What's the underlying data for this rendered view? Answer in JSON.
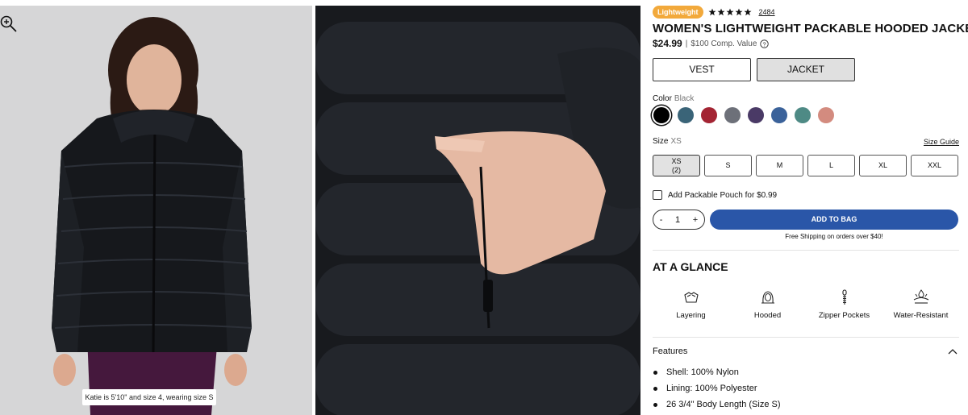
{
  "gallery": {
    "caption": "Katie is 5'10\" and size 4, wearing size S"
  },
  "product": {
    "badge": "Lightweight",
    "rating_stars": 5,
    "review_count": "2484",
    "title": "WOMEN'S LIGHTWEIGHT PACKABLE HOODED JACKET",
    "price": "$24.99",
    "price_separator": "|",
    "comp_value": "$100 Comp. Value"
  },
  "style_options": {
    "vest": "VEST",
    "jacket": "JACKET",
    "selected": "JACKET"
  },
  "color": {
    "label": "Color",
    "selected_name": "Black",
    "swatches": [
      "#000000",
      "#3a6478",
      "#a32433",
      "#6d7079",
      "#4a3a66",
      "#3b629a",
      "#4e8a85",
      "#d38b7f"
    ]
  },
  "size": {
    "label": "Size",
    "selected": "XS",
    "guide_label": "Size Guide",
    "options": [
      {
        "label": "XS",
        "stock": "(2)"
      },
      {
        "label": "S"
      },
      {
        "label": "M"
      },
      {
        "label": "L"
      },
      {
        "label": "XL"
      },
      {
        "label": "XXL"
      }
    ]
  },
  "add_on": {
    "label": "Add Packable Pouch for $0.99"
  },
  "cart": {
    "minus": "-",
    "quantity": "1",
    "plus": "+",
    "add_label": "ADD TO BAG",
    "shipping_note": "Free Shipping on orders over $40!"
  },
  "glance": {
    "title": "AT A GLANCE",
    "items": [
      {
        "label": "Layering",
        "icon": "layering-icon"
      },
      {
        "label": "Hooded",
        "icon": "hood-icon"
      },
      {
        "label": "Zipper Pockets",
        "icon": "zipper-icon"
      },
      {
        "label": "Water-Resistant",
        "icon": "water-resistant-icon"
      }
    ]
  },
  "features": {
    "title": "Features",
    "items": [
      "Shell: 100% Nylon",
      "Lining: 100% Polyester",
      "26 3/4\" Body Length (Size S)"
    ]
  },
  "colors": {
    "accent_blue": "#2a56a8",
    "badge_orange": "#f2a93b"
  }
}
